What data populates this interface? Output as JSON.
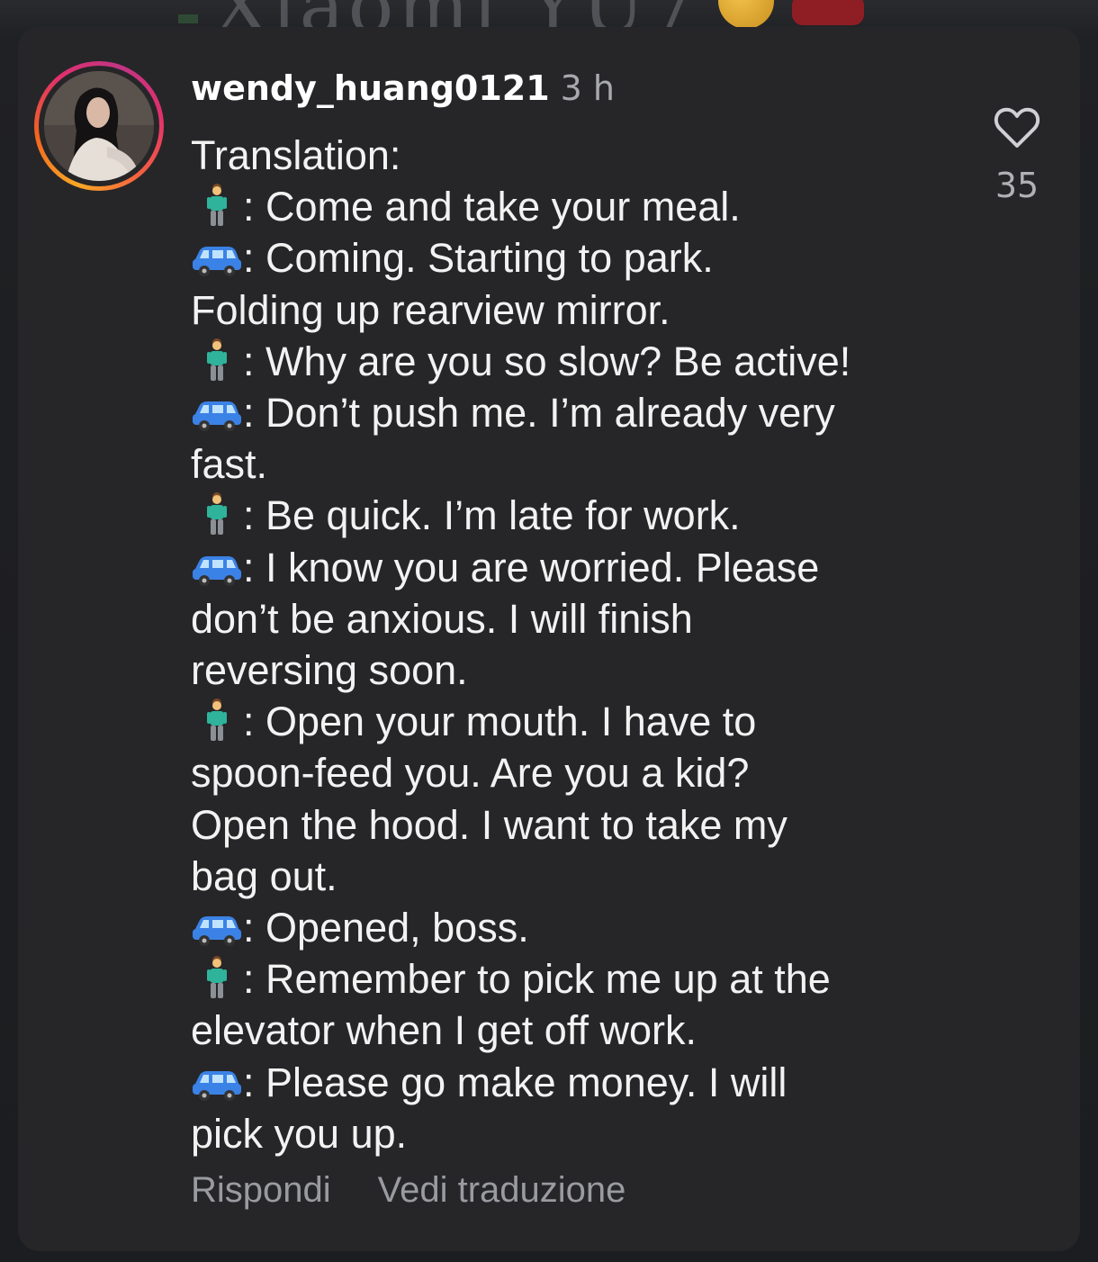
{
  "background": {
    "partial_text": "Xiaomi YU7"
  },
  "comment": {
    "username": "wendy_huang0121",
    "timestamp": "3 h",
    "like_count": "35",
    "lines": [
      {
        "speaker": null,
        "text": "Translation:"
      },
      {
        "speaker": "man-icon",
        "text": ": Come and take your meal."
      },
      {
        "speaker": "car-icon",
        "text": ": Coming. Starting to park."
      },
      {
        "speaker": null,
        "text": "Folding up rearview mirror."
      },
      {
        "speaker": "man-icon",
        "text": ": Why are you so slow? Be active!"
      },
      {
        "speaker": "car-icon",
        "text": ": Don’t push me. I’m already very"
      },
      {
        "speaker": null,
        "text": "fast."
      },
      {
        "speaker": "man-icon",
        "text": ": Be quick. I’m late for work."
      },
      {
        "speaker": "car-icon",
        "text": ": I know you are worried. Please"
      },
      {
        "speaker": null,
        "text": "don’t be anxious. I will finish"
      },
      {
        "speaker": null,
        "text": "reversing soon."
      },
      {
        "speaker": "man-icon",
        "text": ": Open your mouth. I have to"
      },
      {
        "speaker": null,
        "text": "spoon-feed you. Are you a kid?"
      },
      {
        "speaker": null,
        "text": "Open the hood. I want to take my"
      },
      {
        "speaker": null,
        "text": "bag out."
      },
      {
        "speaker": "car-icon",
        "text": ": Opened, boss."
      },
      {
        "speaker": "man-icon",
        "text": ": Remember to pick me up at the"
      },
      {
        "speaker": null,
        "text": "elevator when I get off work."
      },
      {
        "speaker": "car-icon",
        "text": ": Please go make money. I will"
      },
      {
        "speaker": null,
        "text": "pick you up."
      }
    ],
    "reply_label": "Rispondi",
    "translate_label": "Vedi traduzione"
  },
  "colors": {
    "card_bg": "#262628",
    "text": "#f2f2f2",
    "muted": "#9a9ba0",
    "car_blue": "#3b82e6",
    "man_shirt": "#2fb39a"
  }
}
